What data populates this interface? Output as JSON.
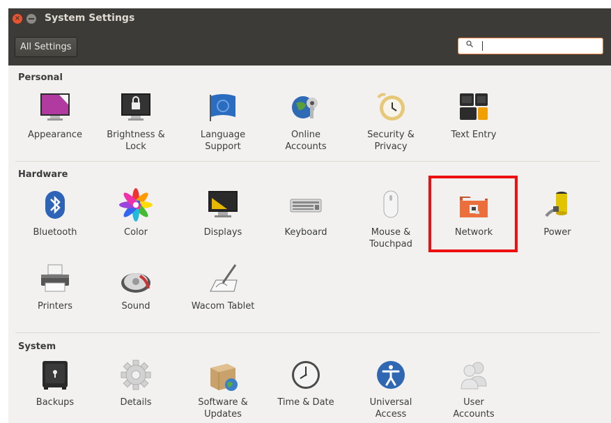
{
  "window": {
    "title": "System Settings"
  },
  "toolbar": {
    "all_settings": "All Settings"
  },
  "sections": {
    "personal": {
      "title": "Personal",
      "items": [
        {
          "label1": "Appearance",
          "label2": ""
        },
        {
          "label1": "Brightness &",
          "label2": "Lock"
        },
        {
          "label1": "Language",
          "label2": "Support"
        },
        {
          "label1": "Online",
          "label2": "Accounts"
        },
        {
          "label1": "Security &",
          "label2": "Privacy"
        },
        {
          "label1": "Text Entry",
          "label2": ""
        }
      ]
    },
    "hardware": {
      "title": "Hardware",
      "items": [
        {
          "label1": "Bluetooth",
          "label2": ""
        },
        {
          "label1": "Color",
          "label2": ""
        },
        {
          "label1": "Displays",
          "label2": ""
        },
        {
          "label1": "Keyboard",
          "label2": ""
        },
        {
          "label1": "Mouse &",
          "label2": "Touchpad"
        },
        {
          "label1": "Network",
          "label2": ""
        },
        {
          "label1": "Power",
          "label2": ""
        },
        {
          "label1": "Printers",
          "label2": ""
        },
        {
          "label1": "Sound",
          "label2": ""
        },
        {
          "label1": "Wacom Tablet",
          "label2": ""
        }
      ]
    },
    "system": {
      "title": "System",
      "items": [
        {
          "label1": "Backups",
          "label2": ""
        },
        {
          "label1": "Details",
          "label2": ""
        },
        {
          "label1": "Software &",
          "label2": "Updates"
        },
        {
          "label1": "Time & Date",
          "label2": ""
        },
        {
          "label1": "Universal",
          "label2": "Access"
        },
        {
          "label1": "User",
          "label2": "Accounts"
        }
      ]
    }
  },
  "colors": {
    "titlebar": "#3c3b37",
    "close": "#e9542f",
    "highlight": "#ee1010",
    "search_border": "#e87e3c"
  }
}
